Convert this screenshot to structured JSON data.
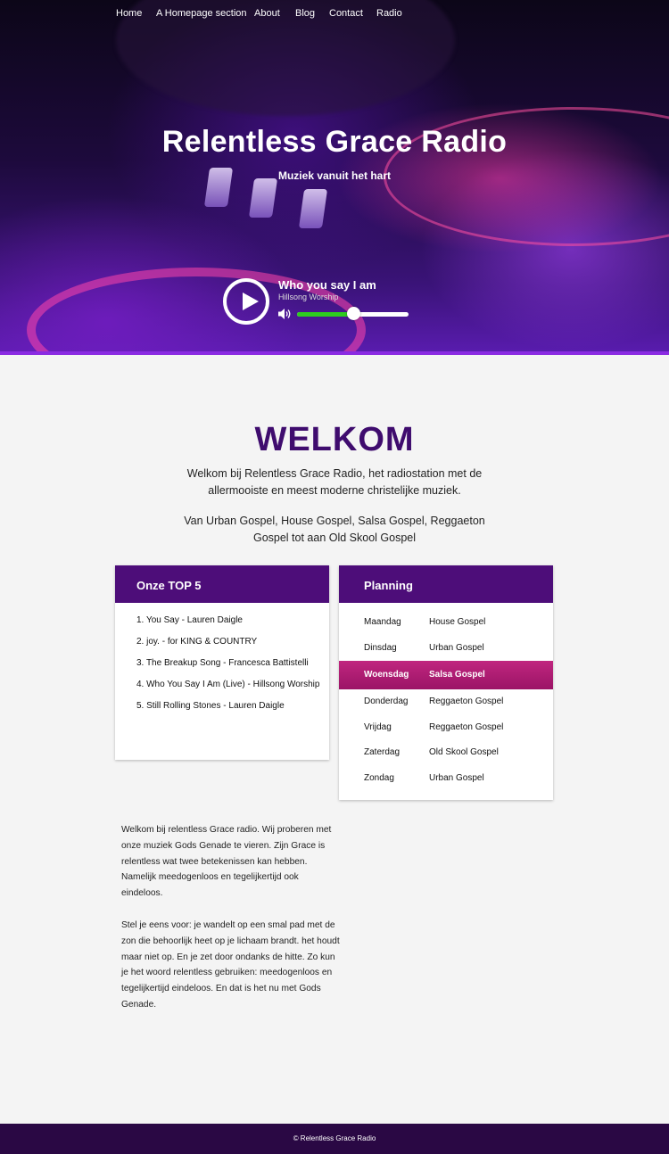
{
  "nav": {
    "items": [
      "Home",
      "A Homepage section",
      "About",
      "Blog",
      "Contact",
      "Radio"
    ]
  },
  "hero": {
    "title": "Relentless Grace Radio",
    "subtitle": "Muziek vanuit het hart"
  },
  "player": {
    "track_title": "Who you say I am",
    "track_artist": "Hillsong Worship",
    "volume_fraction": 0.5,
    "icons": [
      "play-icon",
      "speaker-icon"
    ]
  },
  "welcome": {
    "heading": "WELKOM",
    "intro_1": "Welkom bij Relentless Grace Radio, het radiostation met de allermooiste en meest moderne christelijke muziek.",
    "intro_2": "Van Urban Gospel, House Gospel, Salsa Gospel, Reggaeton Gospel tot aan Old Skool Gospel"
  },
  "top5": {
    "title": "Onze TOP 5",
    "items": [
      "1. You Say - Lauren Daigle",
      "2. joy. - for KING & COUNTRY",
      "3. The Breakup Song - Francesca Battistelli",
      "4. Who You Say I Am (Live) - Hillsong Worship",
      "5. Still Rolling Stones - Lauren Daigle"
    ]
  },
  "planning": {
    "title": "Planning",
    "rows": [
      {
        "day": "Maandag",
        "genre": "House Gospel",
        "active": false
      },
      {
        "day": "Dinsdag",
        "genre": "Urban Gospel",
        "active": false
      },
      {
        "day": "Woensdag",
        "genre": "Salsa Gospel",
        "active": true
      },
      {
        "day": "Donderdag",
        "genre": "Reggaeton Gospel",
        "active": false
      },
      {
        "day": "Vrijdag",
        "genre": "Reggaeton Gospel",
        "active": false
      },
      {
        "day": "Zaterdag",
        "genre": "Old Skool Gospel",
        "active": false
      },
      {
        "day": "Zondag",
        "genre": "Urban Gospel",
        "active": false
      }
    ]
  },
  "body": {
    "paragraph_1": "Welkom bij relentless Grace radio. Wij proberen met onze muziek Gods Genade te vieren. Zijn Grace is relentless wat twee betekenissen kan hebben. Namelijk meedogenloos en tegelijkertijd ook eindeloos.",
    "paragraph_2": "Stel je eens voor: je wandelt op een smal pad met de zon die behoorlijk heet op je lichaam brandt. het houdt maar niet op. En je zet door ondanks de hitte. Zo kun je het woord relentless gebruiken: meedogenloos en tegelijkertijd eindeloos. En dat is het nu met Gods Genade."
  },
  "footer": {
    "text": "© Relentless Grace Radio"
  },
  "colors": {
    "accent_purple": "#4d0d79",
    "heading_purple": "#3f0c6e",
    "active_row_pink": "#b01e76",
    "volume_green": "#2ecc1f",
    "footer_bg": "#2a0844"
  }
}
